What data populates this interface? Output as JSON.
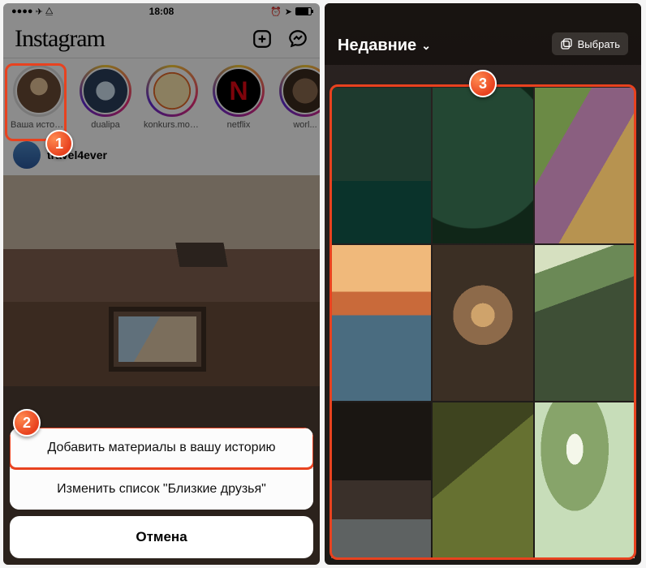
{
  "statusbar": {
    "time": "18:08"
  },
  "left": {
    "app_name": "Instagram",
    "stories": [
      {
        "label": "Ваша история"
      },
      {
        "label": "dualipa"
      },
      {
        "label": "konkurs.mos..."
      },
      {
        "label": "netflix"
      },
      {
        "label": "worl..."
      }
    ],
    "post": {
      "username": "travel4ever"
    },
    "sheet": {
      "add_story": "Добавить материалы в вашу историю",
      "close_friends": "Изменить список \"Близкие друзья\"",
      "cancel": "Отмена"
    }
  },
  "right": {
    "header": {
      "title": "Недавние",
      "select": "Выбрать"
    }
  },
  "callouts": {
    "one": "1",
    "two": "2",
    "three": "3"
  }
}
